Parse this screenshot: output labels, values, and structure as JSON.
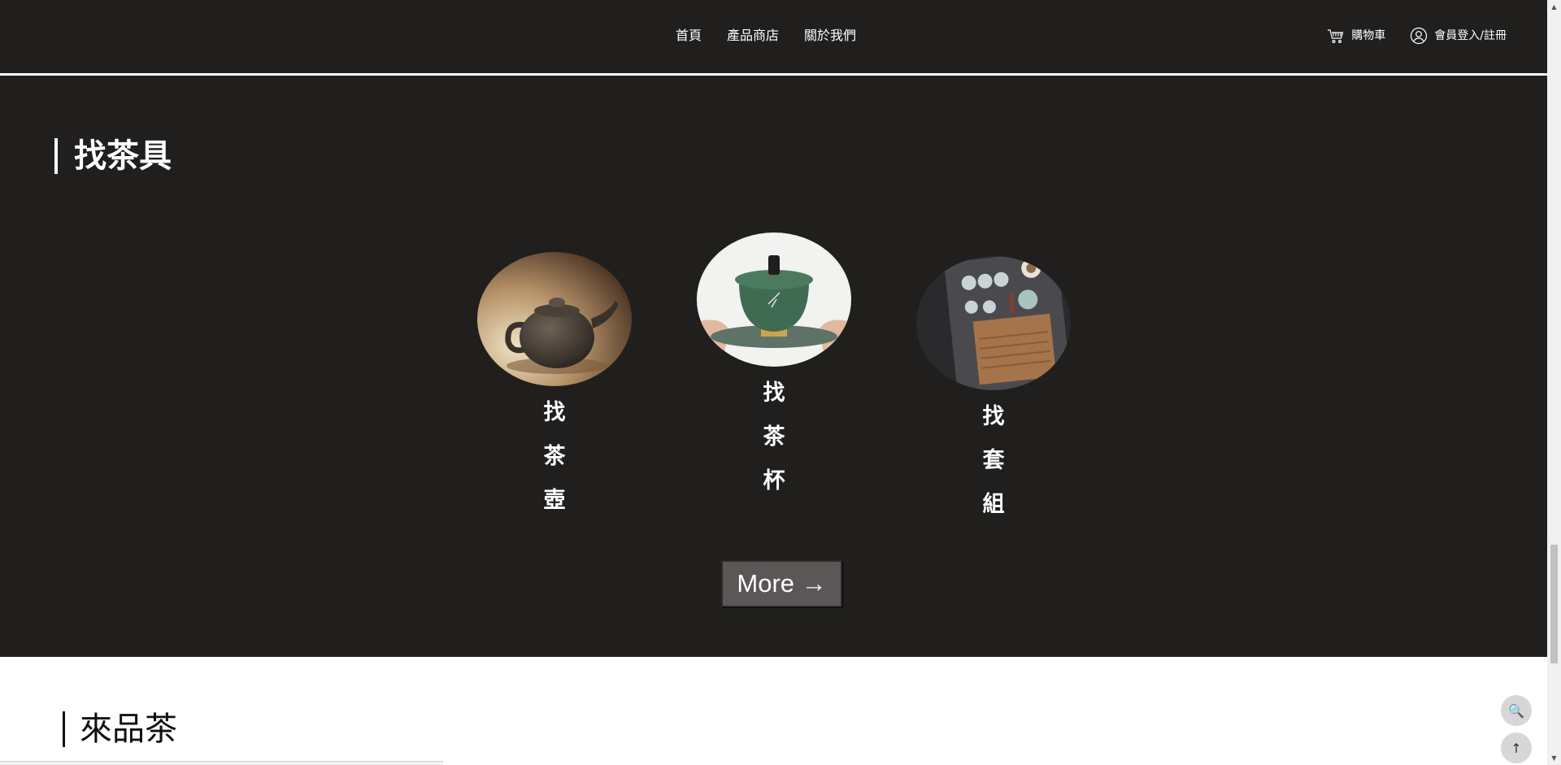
{
  "nav": {
    "items": [
      {
        "label": "首頁"
      },
      {
        "label": "產品商店"
      },
      {
        "label": "關於我們"
      }
    ]
  },
  "header": {
    "cart_label": "購物車",
    "cart_icon": "cart-icon",
    "login_label": "會員登入/註冊",
    "login_icon": "user-icon"
  },
  "tea_tools": {
    "title": "找茶具",
    "categories": [
      {
        "label": "找茶壺",
        "image": "teapot-image"
      },
      {
        "label": "找茶杯",
        "image": "teacup-image"
      },
      {
        "label": "找套組",
        "image": "tea-set-image"
      }
    ],
    "more_label": "More →"
  },
  "tea_section": {
    "title": "來品茶"
  },
  "floating": {
    "search_icon": "🔍",
    "top_icon": "↑"
  },
  "colors": {
    "dark_bg": "#201f1e",
    "button_bg": "#5c5656",
    "text_light": "#ffffff",
    "text_dark": "#111111"
  }
}
